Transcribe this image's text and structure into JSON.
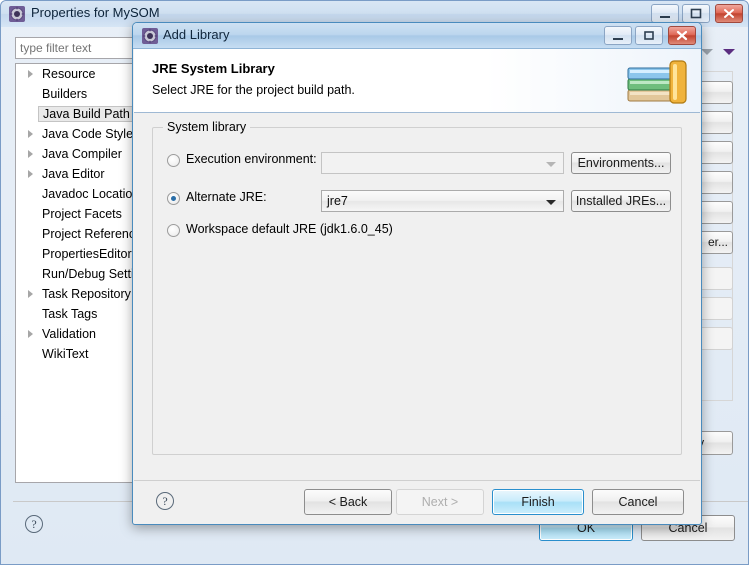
{
  "background_window": {
    "title": "Properties for MySOM",
    "icon": "eclipse-icon",
    "controls": {
      "minimize": "minimize-button",
      "maximize": "maximize-button",
      "close": "close-button"
    },
    "filter": {
      "placeholder": "type filter text",
      "value": ""
    },
    "tree_items": [
      {
        "label": "Resource",
        "expandable": true,
        "selected": false
      },
      {
        "label": "Builders",
        "expandable": false,
        "selected": false
      },
      {
        "label": "Java Build Path",
        "expandable": false,
        "selected": true
      },
      {
        "label": "Java Code Style",
        "expandable": true,
        "selected": false
      },
      {
        "label": "Java Compiler",
        "expandable": true,
        "selected": false
      },
      {
        "label": "Java Editor",
        "expandable": true,
        "selected": false
      },
      {
        "label": "Javadoc Location",
        "expandable": false,
        "selected": false
      },
      {
        "label": "Project Facets",
        "expandable": false,
        "selected": false
      },
      {
        "label": "Project References",
        "expandable": false,
        "selected": false
      },
      {
        "label": "PropertiesEditor",
        "expandable": false,
        "selected": false
      },
      {
        "label": "Run/Debug Settings",
        "expandable": false,
        "selected": false
      },
      {
        "label": "Task Repository",
        "expandable": true,
        "selected": false
      },
      {
        "label": "Task Tags",
        "expandable": false,
        "selected": false
      },
      {
        "label": "Validation",
        "expandable": true,
        "selected": false
      },
      {
        "label": "WikiText",
        "expandable": false,
        "selected": false
      }
    ],
    "side_buttons": [
      {
        "label": "",
        "disabled": false
      },
      {
        "label": "",
        "disabled": false
      },
      {
        "label": "",
        "disabled": false
      },
      {
        "label": "",
        "disabled": false
      },
      {
        "label": "",
        "disabled": false
      },
      {
        "label": "er...",
        "disabled": false
      },
      {
        "label": "",
        "disabled": true
      },
      {
        "label": "",
        "disabled": true
      },
      {
        "label": "",
        "disabled": true
      }
    ],
    "apply_label": "y",
    "ok_label": "OK",
    "cancel_label": "Cancel",
    "help_icon": "help-icon"
  },
  "dialog": {
    "title": "Add Library",
    "icon": "eclipse-icon",
    "controls": {
      "minimize": "minimize-button",
      "maximize": "maximize-button",
      "close": "close-button"
    },
    "header": {
      "title": "JRE System Library",
      "subtitle": "Select JRE for the project build path.",
      "icon": "books-stack-icon"
    },
    "group": {
      "legend": "System library",
      "options": [
        {
          "id": "execution-environment",
          "label": "Execution environment:",
          "checked": false,
          "combo_value": "",
          "combo_enabled": false,
          "button_label": "Environments..."
        },
        {
          "id": "alternate-jre",
          "label": "Alternate JRE:",
          "checked": true,
          "combo_value": "jre7",
          "combo_enabled": true,
          "button_label": "Installed JREs..."
        },
        {
          "id": "workspace-default-jre",
          "label": "Workspace default JRE (jdk1.6.0_45)",
          "checked": false
        }
      ]
    },
    "footer": {
      "help_icon": "help-icon",
      "back_label": "< Back",
      "next_label": "Next >",
      "next_disabled": true,
      "finish_label": "Finish",
      "cancel_label": "Cancel"
    }
  },
  "colors": {
    "accent_blue": "#2a8fcd",
    "titlebar_blue": "#bcd6ee",
    "close_red": "#c2432f",
    "radio_dot": "#2a6ea8"
  }
}
